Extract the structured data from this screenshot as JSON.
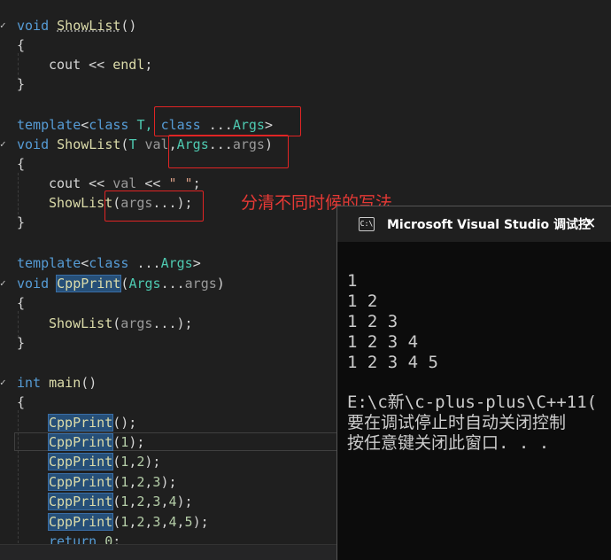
{
  "editor": {
    "lines": {
      "l1": [
        "void",
        " ",
        "ShowList",
        "()"
      ],
      "l2": [
        "{"
      ],
      "l3": [
        "cout",
        " << ",
        "endl",
        ";"
      ],
      "l4": [
        "}"
      ],
      "l6": [
        "template",
        "<",
        "class",
        " T, ",
        "class",
        " ...",
        "Args",
        ">"
      ],
      "l7": [
        "void",
        " ",
        "ShowList",
        "(",
        "T",
        " ",
        "val",
        ",",
        "Args",
        "...",
        "args",
        ")"
      ],
      "l8": [
        "{"
      ],
      "l9": [
        "cout",
        " << ",
        "val",
        " << ",
        "\" \"",
        ";"
      ],
      "l10": [
        "ShowList",
        "(",
        "args",
        "...);"
      ],
      "l11": [
        "}"
      ],
      "l13": [
        "template",
        "<",
        "class",
        " ...",
        "Args",
        ">"
      ],
      "l14": [
        "void",
        " ",
        "CppPrint",
        "(",
        "Args",
        "...",
        "args",
        ")"
      ],
      "l15": [
        "{"
      ],
      "l16": [
        "ShowList",
        "(",
        "args",
        "...);"
      ],
      "l17": [
        "}"
      ],
      "l19": [
        "int",
        " ",
        "main",
        "()"
      ],
      "l20": [
        "{"
      ],
      "l21": [
        "CppPrint",
        "();"
      ],
      "l22": [
        "CppPrint",
        "(",
        "1",
        ");"
      ],
      "l23": [
        "CppPrint",
        "(",
        "1",
        ",",
        "2",
        ");"
      ],
      "l24": [
        "CppPrint",
        "(",
        "1",
        ",",
        "2",
        ",",
        "3",
        ");"
      ],
      "l25": [
        "CppPrint",
        "(",
        "1",
        ",",
        "2",
        ",",
        "3",
        ",",
        "4",
        ");"
      ],
      "l26": [
        "CppPrint",
        "(",
        "1",
        ",",
        "2",
        ",",
        "3",
        ",",
        "4",
        ",",
        "5",
        ");"
      ],
      "l27": [
        "return",
        " ",
        "0",
        ";"
      ]
    }
  },
  "annotation": "分清不同时候的写法",
  "console": {
    "title": "Microsoft Visual Studio 调试控",
    "icon_text": "C:\\",
    "close": "✕",
    "lines": [
      "1",
      "1 2",
      "1 2 3",
      "1 2 3 4",
      "1 2 3 4 5",
      "",
      "E:\\c新\\c-plus-plus\\C++11(",
      "要在调试停止时自动关闭控制",
      "按任意键关闭此窗口. . ."
    ]
  },
  "colors": {
    "editor_bg": "#1f1f1f",
    "keyword": "#569cd6",
    "function": "#dcdcaa",
    "type": "#4ec9b0",
    "annotation_red": "#e02424",
    "console_bg": "#0c0c0c"
  },
  "icons": {
    "console_app": "console-app-icon",
    "close": "close-icon",
    "fold": "fold-chevron-icon"
  }
}
